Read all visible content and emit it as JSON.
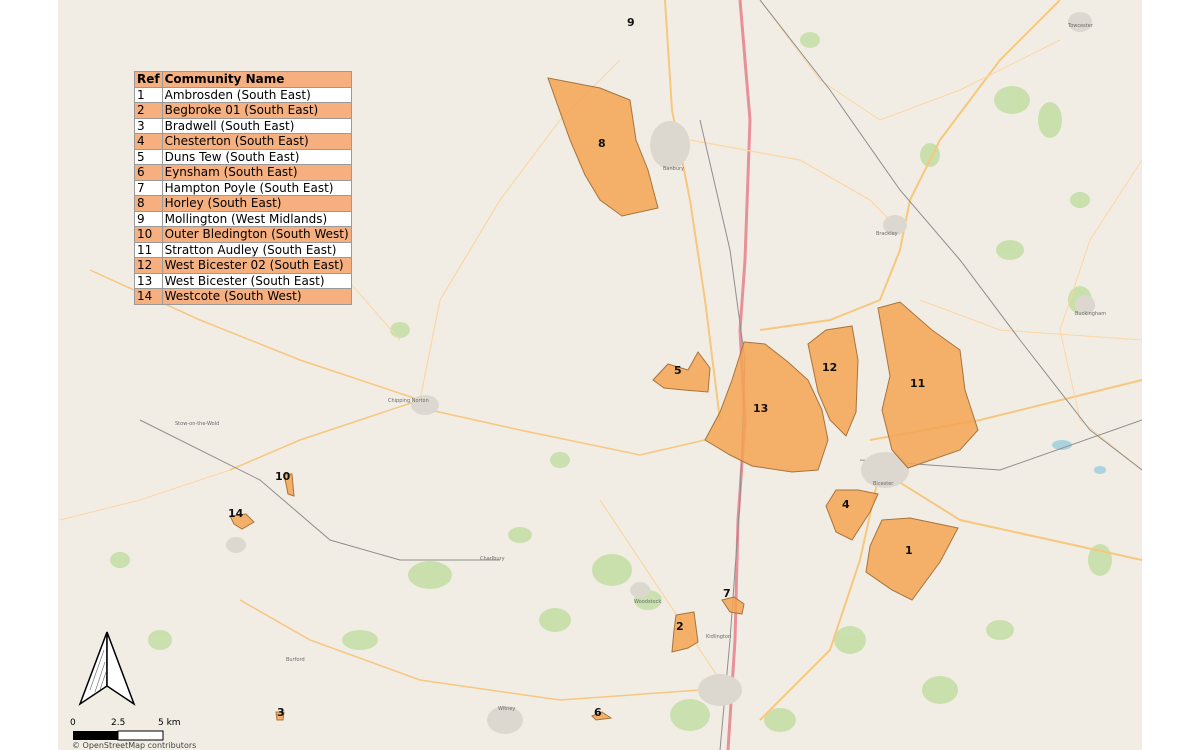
{
  "legend": {
    "header_ref": "Ref",
    "header_name": "Community Name",
    "rows": [
      {
        "ref": "1",
        "name": "Ambrosden (South East)"
      },
      {
        "ref": "2",
        "name": "Begbroke 01 (South East)"
      },
      {
        "ref": "3",
        "name": "Bradwell (South East)"
      },
      {
        "ref": "4",
        "name": "Chesterton (South East)"
      },
      {
        "ref": "5",
        "name": "Duns Tew (South East)"
      },
      {
        "ref": "6",
        "name": "Eynsham (South East)"
      },
      {
        "ref": "7",
        "name": "Hampton Poyle (South East)"
      },
      {
        "ref": "8",
        "name": "Horley (South East)"
      },
      {
        "ref": "9",
        "name": "Mollington (West Midlands)"
      },
      {
        "ref": "10",
        "name": "Outer Bledington (South West)"
      },
      {
        "ref": "11",
        "name": "Stratton Audley (South East)"
      },
      {
        "ref": "12",
        "name": "West Bicester 02 (South East)"
      },
      {
        "ref": "13",
        "name": "West Bicester (South East)"
      },
      {
        "ref": "14",
        "name": "Westcote (South West)"
      }
    ]
  },
  "polygon_labels": {
    "p1": "1",
    "p2": "2",
    "p3": "3",
    "p4": "4",
    "p5": "5",
    "p6": "6",
    "p7": "7",
    "p8": "8",
    "p9": "9",
    "p10": "10",
    "p11": "11",
    "p12": "12",
    "p13": "13",
    "p14": "14"
  },
  "scale": {
    "zero": "0",
    "mid": "2.5",
    "end": "5 km"
  },
  "attribution": "© OpenStreetMap contributors",
  "places": {
    "banbury": "Banbury",
    "bicester": "Bicester",
    "brackley": "Brackley",
    "buckingham": "Buckingham",
    "towcester": "Towcester",
    "chipping_norton": "Chipping Norton",
    "woodstock": "Woodstock",
    "witney": "Witney",
    "kidlington": "Kidlington",
    "charlbury": "Charlbury",
    "stow": "Stow-on-the-Wold",
    "burford": "Burford"
  },
  "colors": {
    "polygon_fill": "#f5a354",
    "polygon_stroke": "#a8743c",
    "legend_highlight": "#f6b07f",
    "map_background": "#f1ede4",
    "woodland": "#c5dfa8",
    "motorway": "#e8909a",
    "trunk": "#f7c77e",
    "water": "#aad3df"
  },
  "north_arrow_icon": "north-arrow-icon"
}
